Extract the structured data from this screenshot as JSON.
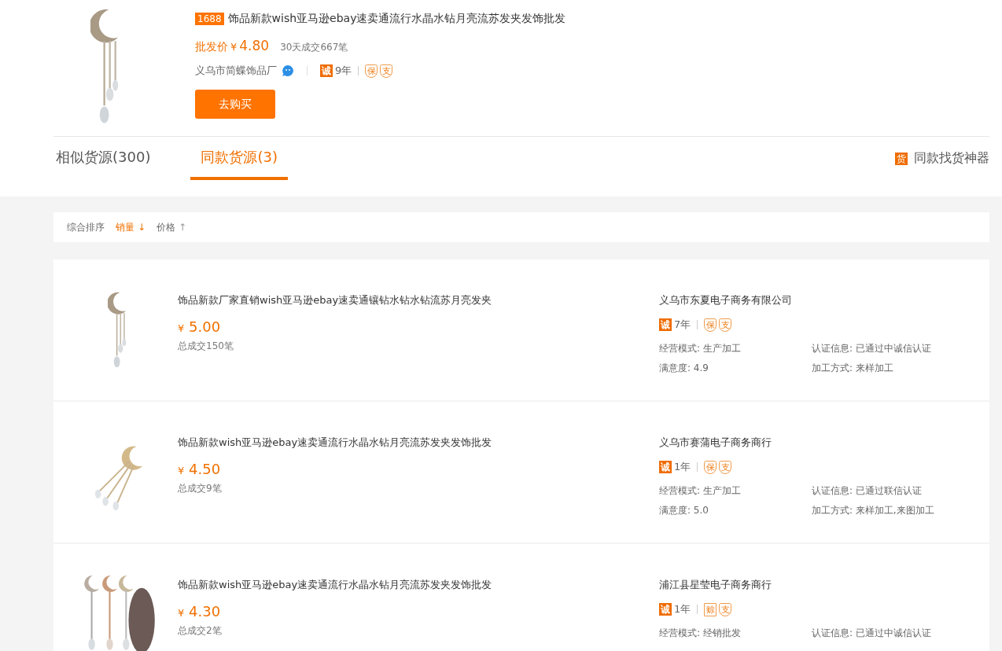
{
  "product": {
    "logo": "1688",
    "title": "饰品新款wish亚马逊ebay速卖通流行水晶水钻月亮流苏发夹发饰批发",
    "price_label": "批发价",
    "currency": "¥",
    "price": "4.80",
    "sales": "30天成交667笔",
    "supplier": "义乌市简蝶饰品厂",
    "integrity_badge": "诚",
    "years": "9年",
    "badges": [
      {
        "text": "保",
        "kind": "shield"
      },
      {
        "text": "支",
        "kind": "shield"
      }
    ],
    "buy_button": "去购买"
  },
  "tabs": [
    {
      "label": "相似货源(300)",
      "selected": false
    },
    {
      "label": "同款货源(3)",
      "selected": true
    }
  ],
  "finder": {
    "badge": "货",
    "label": "同款找货神器"
  },
  "sort_options": [
    {
      "label": "综合排序",
      "selected": false
    },
    {
      "label": "销量",
      "arrow": "↓",
      "selected": true
    },
    {
      "label": "价格",
      "arrow": "↑",
      "selected": false
    }
  ],
  "results": [
    {
      "title": "饰品新款厂家直销wish亚马逊ebay速卖通镶钻水钻水钻流苏月亮发夹",
      "currency": "¥",
      "price": "5.00",
      "sales": "总成交150笔",
      "company": "义乌市东夏电子商务有限公司",
      "integrity_badge": "诚",
      "years": "7年",
      "badges": [
        {
          "text": "保",
          "kind": "shield"
        },
        {
          "text": "支",
          "kind": "shield"
        }
      ],
      "details": [
        "经营模式: 生产加工",
        "认证信息: 已通过中诚信认证",
        "满意度: 4.9",
        "加工方式: 来样加工"
      ]
    },
    {
      "title": "饰品新款wish亚马逊ebay速卖通流行水晶水钻月亮流苏发夹发饰批发",
      "currency": "¥",
      "price": "4.50",
      "sales": "总成交9笔",
      "company": "义乌市赛蒲电子商务商行",
      "integrity_badge": "诚",
      "years": "1年",
      "badges": [
        {
          "text": "保",
          "kind": "shield"
        },
        {
          "text": "支",
          "kind": "shield"
        }
      ],
      "details": [
        "经营模式: 生产加工",
        "认证信息: 已通过联信认证",
        "满意度: 5.0",
        "加工方式: 来样加工,来图加工"
      ]
    },
    {
      "title": "饰品新款wish亚马逊ebay速卖通流行水晶水钻月亮流苏发夹发饰批发",
      "currency": "¥",
      "price": "4.30",
      "sales": "总成交2笔",
      "company": "浦江县星莹电子商务商行",
      "integrity_badge": "诚",
      "years": "1年",
      "badges": [
        {
          "text": "赊",
          "kind": "square"
        },
        {
          "text": "支",
          "kind": "shield"
        }
      ],
      "details": [
        "经营模式: 经销批发",
        "认证信息: 已通过中诚信认证"
      ]
    }
  ]
}
